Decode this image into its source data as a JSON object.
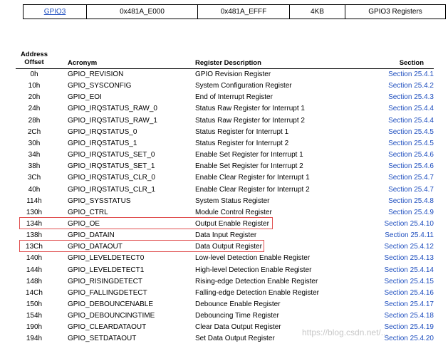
{
  "module_row": {
    "name": "GPIO3",
    "start": "0x481A_E000",
    "end": "0x481A_EFFF",
    "size": "4KB",
    "description": "GPIO3 Registers"
  },
  "headers": {
    "offset_line1": "Address",
    "offset_line2": "Offset",
    "acronym": "Acronym",
    "description": "Register Description",
    "section": "Section"
  },
  "rows": [
    {
      "offset": "0h",
      "acronym": "GPIO_REVISION",
      "description": "GPIO Revision Register",
      "section": "Section 25.4.1"
    },
    {
      "offset": "10h",
      "acronym": "GPIO_SYSCONFIG",
      "description": "System Configuration Register",
      "section": "Section 25.4.2"
    },
    {
      "offset": "20h",
      "acronym": "GPIO_EOI",
      "description": "End of Interrupt Register",
      "section": "Section 25.4.3"
    },
    {
      "offset": "24h",
      "acronym": "GPIO_IRQSTATUS_RAW_0",
      "description": "Status Raw Register for Interrupt 1",
      "section": "Section 25.4.4"
    },
    {
      "offset": "28h",
      "acronym": "GPIO_IRQSTATUS_RAW_1",
      "description": "Status Raw Register for Interrupt 2",
      "section": "Section 25.4.4"
    },
    {
      "offset": "2Ch",
      "acronym": "GPIO_IRQSTATUS_0",
      "description": "Status Register for Interrupt 1",
      "section": "Section 25.4.5"
    },
    {
      "offset": "30h",
      "acronym": "GPIO_IRQSTATUS_1",
      "description": "Status Register for Interrupt 2",
      "section": "Section 25.4.5"
    },
    {
      "offset": "34h",
      "acronym": "GPIO_IRQSTATUS_SET_0",
      "description": "Enable Set Register for Interrupt 1",
      "section": "Section 25.4.6"
    },
    {
      "offset": "38h",
      "acronym": "GPIO_IRQSTATUS_SET_1",
      "description": "Enable Set Register for Interrupt 2",
      "section": "Section 25.4.6"
    },
    {
      "offset": "3Ch",
      "acronym": "GPIO_IRQSTATUS_CLR_0",
      "description": "Enable Clear Register for Interrupt 1",
      "section": "Section 25.4.7"
    },
    {
      "offset": "40h",
      "acronym": "GPIO_IRQSTATUS_CLR_1",
      "description": "Enable Clear Register for Interrupt 2",
      "section": "Section 25.4.7"
    },
    {
      "offset": "114h",
      "acronym": "GPIO_SYSSTATUS",
      "description": "System Status Register",
      "section": "Section 25.4.8"
    },
    {
      "offset": "130h",
      "acronym": "GPIO_CTRL",
      "description": "Module Control Register",
      "section": "Section 25.4.9"
    },
    {
      "offset": "134h",
      "acronym": "GPIO_OE",
      "description": "Output Enable Register",
      "section": "Section 25.4.10"
    },
    {
      "offset": "138h",
      "acronym": "GPIO_DATAIN",
      "description": "Data Input Register",
      "section": "Section 25.4.11"
    },
    {
      "offset": "13Ch",
      "acronym": "GPIO_DATAOUT",
      "description": "Data Output Register",
      "section": "Section 25.4.12"
    },
    {
      "offset": "140h",
      "acronym": "GPIO_LEVELDETECT0",
      "description": "Low-level Detection Enable Register",
      "section": "Section 25.4.13"
    },
    {
      "offset": "144h",
      "acronym": "GPIO_LEVELDETECT1",
      "description": "High-level Detection Enable Register",
      "section": "Section 25.4.14"
    },
    {
      "offset": "148h",
      "acronym": "GPIO_RISINGDETECT",
      "description": "Rising-edge Detection Enable Register",
      "section": "Section 25.4.15"
    },
    {
      "offset": "14Ch",
      "acronym": "GPIO_FALLINGDETECT",
      "description": "Falling-edge Detection Enable Register",
      "section": "Section 25.4.16"
    },
    {
      "offset": "150h",
      "acronym": "GPIO_DEBOUNCENABLE",
      "description": "Debounce Enable Register",
      "section": "Section 25.4.17"
    },
    {
      "offset": "154h",
      "acronym": "GPIO_DEBOUNCINGTIME",
      "description": "Debouncing Time Register",
      "section": "Section 25.4.18"
    },
    {
      "offset": "190h",
      "acronym": "GPIO_CLEARDATAOUT",
      "description": "Clear Data Output Register",
      "section": "Section 25.4.19"
    },
    {
      "offset": "194h",
      "acronym": "GPIO_SETDATAOUT",
      "description": "Set Data Output Register",
      "section": "Section 25.4.20"
    }
  ],
  "highlighted_rows": [
    "GPIO_OE",
    "GPIO_DATAOUT"
  ],
  "watermark": "https://blog.csdn.net/...",
  "colors": {
    "link": "#1f4fbf",
    "highlight": "#e05050"
  }
}
